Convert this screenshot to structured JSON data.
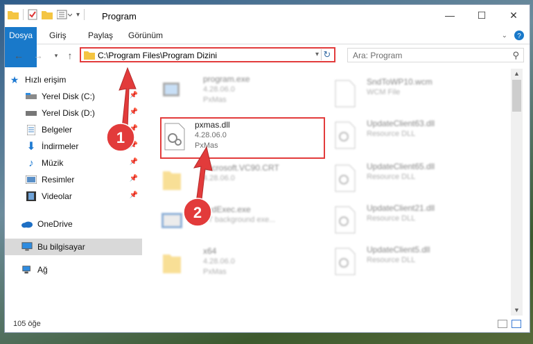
{
  "window": {
    "title": "Program",
    "controls": {
      "minimize": "—",
      "maximize": "☐",
      "close": "✕"
    }
  },
  "ribbon": {
    "tabs": [
      "Dosya",
      "Giriş",
      "Paylaş",
      "Görünüm"
    ]
  },
  "address": {
    "path": "C:\\Program Files\\Program Dizini",
    "search_placeholder": "Ara: Program"
  },
  "nav": {
    "items": [
      {
        "label": "Hızlı erişim",
        "icon": "star-icon",
        "pinned": false
      },
      {
        "label": "Yerel Disk (C:)",
        "icon": "drive-icon",
        "pinned": true
      },
      {
        "label": "Yerel Disk (D:)",
        "icon": "drive-icon",
        "pinned": true
      },
      {
        "label": "Belgeler",
        "icon": "documents-icon",
        "pinned": true
      },
      {
        "label": "İndirmeler",
        "icon": "download-icon",
        "pinned": true
      },
      {
        "label": "Müzik",
        "icon": "music-icon",
        "pinned": true
      },
      {
        "label": "Resimler",
        "icon": "pictures-icon",
        "pinned": true
      },
      {
        "label": "Videolar",
        "icon": "videos-icon",
        "pinned": true
      },
      {
        "label": "OneDrive",
        "icon": "cloud-icon",
        "pinned": false
      },
      {
        "label": "Bu bilgisayar",
        "icon": "computer-icon",
        "pinned": false
      },
      {
        "label": "Ağ",
        "icon": "network-icon",
        "pinned": false
      }
    ]
  },
  "files": {
    "left": [
      {
        "name": "program.exe",
        "line2": "4.28.06.0",
        "line3": "PxMas",
        "icon": "exe-icon"
      },
      {
        "name": "pxmas.dll",
        "line2": "4.28.06.0",
        "line3": "PxMas",
        "icon": "dll-icon"
      },
      {
        "name": "Microsoft.VC90.CRT",
        "line2": "4.28.06.0",
        "line3": "",
        "icon": "folder-icon"
      },
      {
        "name": "sedExec.exe",
        "line2": "ST background exe...",
        "line3": "",
        "icon": "exe-icon"
      },
      {
        "name": "x64",
        "line2": "4.28.06.0",
        "line3": "PxMas",
        "icon": "folder-icon"
      }
    ],
    "right": [
      {
        "name": "SndToWP10.wcm",
        "line2": "WCM File",
        "icon": "file-icon"
      },
      {
        "name": "UpdateClient63.dll",
        "line2": "Resource DLL",
        "icon": "dll-icon"
      },
      {
        "name": "UpdateClient65.dll",
        "line2": "Resource DLL",
        "icon": "dll-icon"
      },
      {
        "name": "UpdateClient21.dll",
        "line2": "Resource DLL",
        "icon": "dll-icon"
      },
      {
        "name": "UpdateClient5.dll",
        "line2": "Resource DLL",
        "icon": "dll-icon"
      }
    ]
  },
  "status": {
    "count": "105 öğe"
  },
  "annotations": {
    "step1": "1",
    "step2": "2",
    "accent": "#e23b3b"
  }
}
